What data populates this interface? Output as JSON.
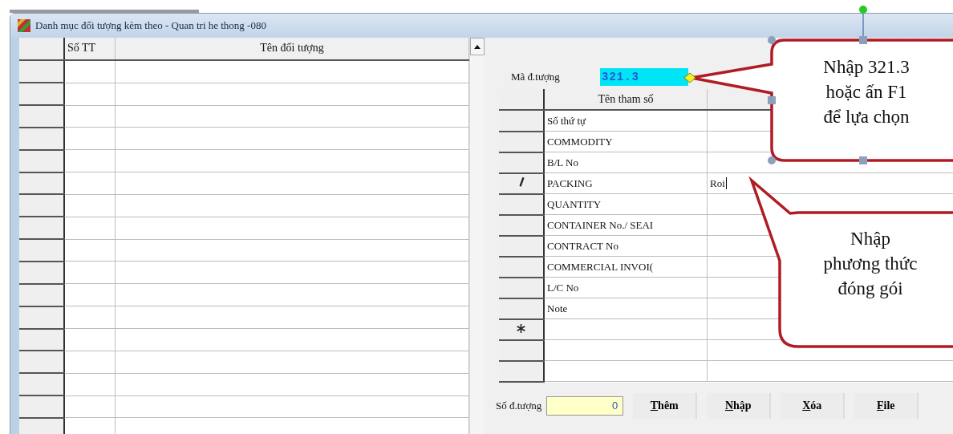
{
  "window": {
    "title": "Danh mục đối tượng kèm theo - Quan tri he thong -080"
  },
  "objects_table": {
    "columns": [
      "Số TT",
      "Tên đối tượng"
    ]
  },
  "object_code": {
    "label": "Mã đ.tượng",
    "value": "321.3"
  },
  "params_table": {
    "columns": [
      "Tên tham số"
    ],
    "rows": [
      {
        "kind": "param",
        "name": "Số thứ tự"
      },
      {
        "kind": "param",
        "name": "COMMODITY"
      },
      {
        "kind": "param",
        "name": "B/L No"
      },
      {
        "kind": "editing",
        "name": "PACKING",
        "value": "Roi"
      },
      {
        "kind": "param",
        "name": "QUANTITY"
      },
      {
        "kind": "param",
        "name": "CONTAINER No./ SEAI"
      },
      {
        "kind": "param",
        "name": "CONTRACT No"
      },
      {
        "kind": "param",
        "name": "COMMERCIAL INVOI("
      },
      {
        "kind": "param",
        "name": "L/C No"
      },
      {
        "kind": "param",
        "name": "Note"
      },
      {
        "kind": "new"
      },
      {
        "kind": "empty"
      },
      {
        "kind": "empty"
      }
    ]
  },
  "count": {
    "label": "Số đ.tượng",
    "value": "0"
  },
  "buttons": [
    "Thêm",
    "Nhập",
    "Xóa",
    "File"
  ],
  "callouts": [
    {
      "lines": [
        "Nhập 321.3",
        "hoặc ấn F1",
        "để lựa chọn"
      ]
    },
    {
      "lines": [
        "Nhập",
        "phương thức",
        "đóng gói"
      ]
    }
  ]
}
